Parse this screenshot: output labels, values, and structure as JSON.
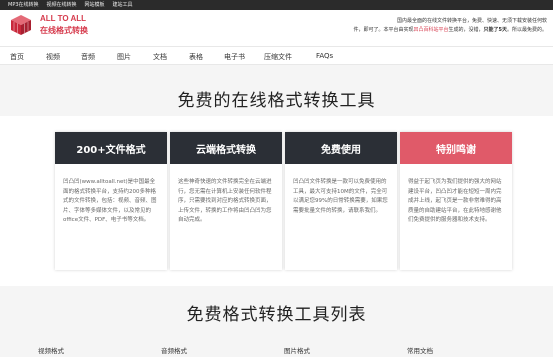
{
  "topbar": {
    "links": [
      "MP3在线转换",
      "视频在线转换",
      "网站模板",
      "建站工具"
    ]
  },
  "header": {
    "logo_en": "ALL TO ALL",
    "logo_cn": "在线格式转换",
    "intro_line1": "国内最全面的在线文件转换平台，免费、快速、无须下载安装任何软",
    "intro_line2_a": "件，即可了。本平台由实现",
    "intro_line2_hl": "凹凸百科站平台",
    "intro_line2_b": "生成的，没错，",
    "intro_line2_bold": "只能了5天",
    "intro_line2_c": "。所以最免费的。"
  },
  "nav": {
    "items": [
      "首页",
      "视频",
      "音频",
      "图片",
      "文档",
      "表格",
      "电子书",
      "压缩文件",
      "FAQs"
    ]
  },
  "hero": {
    "title": "免费的在线格式转换工具"
  },
  "cards": [
    {
      "title": "200+文件格式",
      "color": "#2b2f36",
      "body": "凹凸凹(www.alltoall.net)是中国最全面的格式转换平台，支持约200多种格式的文件转换，包括：视频、音频、图片、字体等多媒体文件，以及常见的office文件、PDF、电子书等文档。"
    },
    {
      "title": "云端格式转换",
      "color": "#2b2f36",
      "body": "这些神奇快速的文件转换完全在云端进行，您无需在计算机上安装任何软件程序，只需要找到对应的格式转换页面，上传文件，转换的工作将由凹凸凹为您自动完成。"
    },
    {
      "title": "免费使用",
      "color": "#2b2f36",
      "body": "凹凸凹文件转换是一款可以免费使用的工具，最大可支持10M的文件，完全可以满足您99%的日常转换需要，如果您需要批量文件的转换，请联系我们。"
    },
    {
      "title": "特别鸣谢",
      "color": "#e05a69",
      "body": "得益于起飞页为我们提供的强大的网站建设平台，凹凸凹才能在短短一周内完成并上线，起飞页是一款非常难得的高质量的自助建站平台，在此特地感谢他们免费提供的服务器和技术支持。"
    }
  ],
  "list": {
    "title": "免费格式转换工具列表",
    "categories": [
      "视频格式",
      "音频格式",
      "图片格式",
      "常用文档"
    ]
  },
  "colors": {
    "brand": "#d63b4d",
    "dark_card": "#2b2f36",
    "accent_card": "#e05a69"
  }
}
